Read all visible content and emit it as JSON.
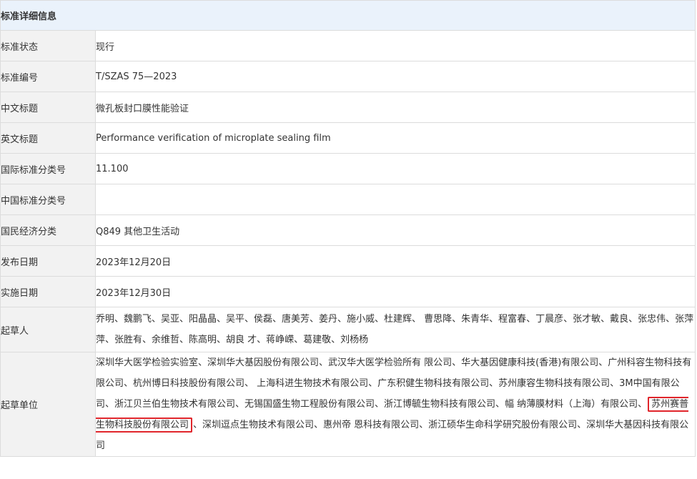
{
  "header": {
    "title": "标准详细信息"
  },
  "rows": [
    {
      "label": "标准状态",
      "value": "现行"
    },
    {
      "label": "标准编号",
      "value": "T/SZAS 75—2023"
    },
    {
      "label": "中文标题",
      "value": "微孔板封口膜性能验证"
    },
    {
      "label": "英文标题",
      "value": "Performance verification of microplate sealing film"
    },
    {
      "label": "国际标准分类号",
      "value": "11.100"
    },
    {
      "label": "中国标准分类号",
      "value": ""
    },
    {
      "label": "国民经济分类",
      "value": "Q849 其他卫生活动"
    },
    {
      "label": "发布日期",
      "value": "2023年12月20日"
    },
    {
      "label": "实施日期",
      "value": "2023年12月30日"
    }
  ],
  "drafters": {
    "label": "起草人",
    "value": "乔明、魏鹏飞、吴亚、阳晶晶、吴平、侯磊、唐美芳、姜丹、施小威、杜建辉、 曹思降、朱青华、程富春、丁晨彦、张才敏、戴良、张忠伟、张萍萍、张胜有、余维哲、陈高明、胡良 才、蒋峥嵘、葛建敬、刘杨杨"
  },
  "units": {
    "label": "起草单位",
    "before": "深圳华大医学检验实验室、深圳华大基因股份有限公司、武汉华大医学检验所有 限公司、华大基因健康科技(香港)有限公司、广州科容生物科技有限公司、杭州博日科技股份有限公司、 上海科进生物技术有限公司、广东积健生物科技有限公司、苏州康容生物科技有限公司、3M中国有限公 司、浙江贝兰伯生物技术有限公司、无锡国盛生物工程股份有限公司、浙江博毓生物科技有限公司、幅 纳薄膜材料（上海）有限公司、",
    "highlight": "苏州赛普生物科技股份有限公司",
    "after": "、深圳逗点生物技术有限公司、惠州帝 恩科技有限公司、浙江硕华生命科学研究股份有限公司、深圳华大基因科技有限公司"
  },
  "colors": {
    "header_bg": "#eaf2fb",
    "label_bg": "#f2f2f2",
    "border": "#dcdcdc",
    "highlight_border": "#e0252b"
  }
}
